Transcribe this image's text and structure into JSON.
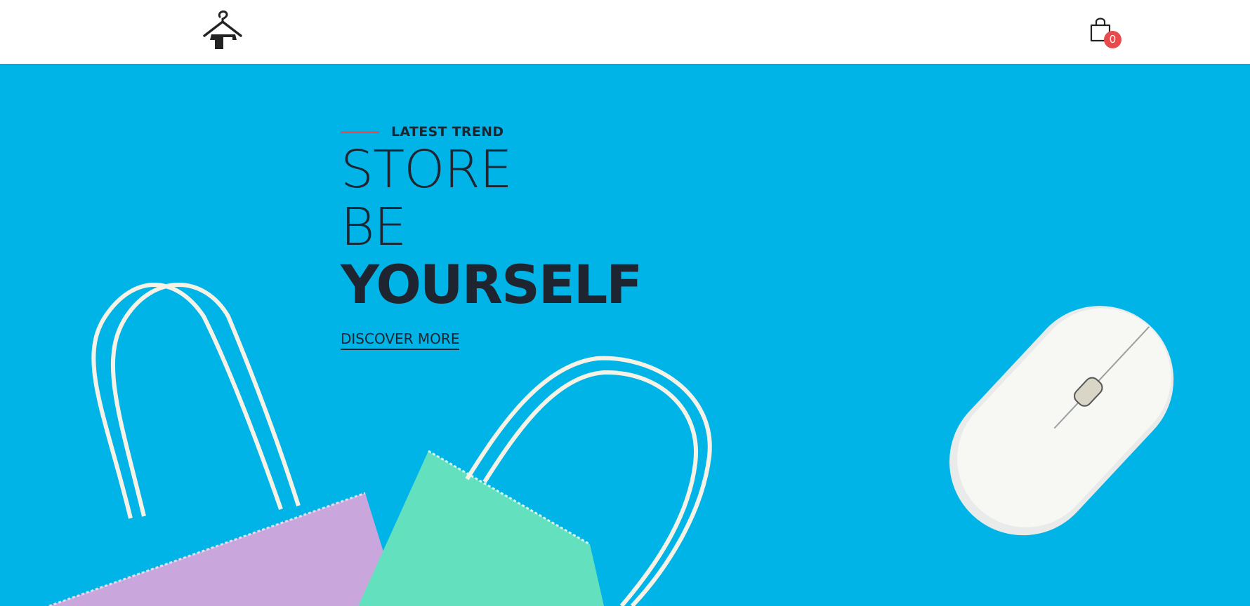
{
  "navbar": {
    "logo_icon": "hanger-logo-icon",
    "cart_icon": "shopping-bag-icon",
    "cart_count": "0",
    "badge_color": "#e84b4b"
  },
  "hero": {
    "background_color": "#00b4e8",
    "eyebrow": "LATEST TREND",
    "headline_line1": "STORE",
    "headline_line2": "BE",
    "headline_line3": "YOURSELF",
    "cta_label": "DISCOVER MORE",
    "accent_color": "#e84b4b",
    "image_subjects": [
      "shopping-bag-purple",
      "shopping-bag-green",
      "computer-mouse"
    ]
  }
}
